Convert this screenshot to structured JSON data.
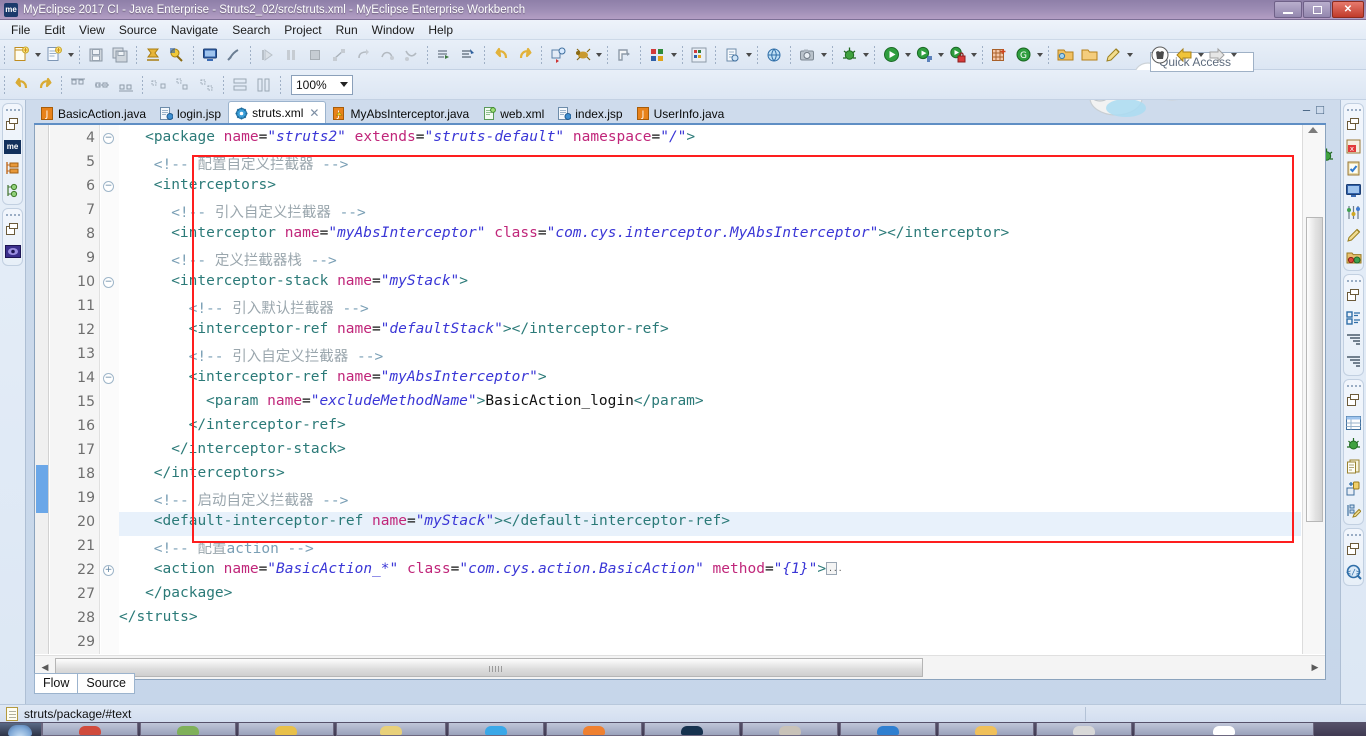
{
  "window": {
    "title": "MyEclipse 2017 CI - Java Enterprise - Struts2_02/src/struts.xml - MyEclipse Enterprise Workbench",
    "app_badge": "me",
    "minimize_label": "–",
    "maximize_label": "❐",
    "close_label": "✕"
  },
  "menubar": {
    "items": [
      {
        "label": "File",
        "mnemonic": "F"
      },
      {
        "label": "Edit",
        "mnemonic": "E"
      },
      {
        "label": "View",
        "mnemonic": "V"
      },
      {
        "label": "Source",
        "mnemonic": "S"
      },
      {
        "label": "Navigate",
        "mnemonic": "N"
      },
      {
        "label": "Search",
        "mnemonic": "c"
      },
      {
        "label": "Project",
        "mnemonic": "P"
      },
      {
        "label": "Run",
        "mnemonic": "R"
      },
      {
        "label": "Window",
        "mnemonic": "W"
      },
      {
        "label": "Help",
        "mnemonic": "H"
      }
    ]
  },
  "toolbar": {
    "zoom_value": "100%",
    "quick_access_placeholder": "Quick Access",
    "row1_icons": [
      "new-wizard-icon",
      "new-wizard-dropdown",
      "new-jsp-icon",
      "new-jsp-dropdown",
      "save-icon",
      "save-all-icon",
      "package-explorer-icon",
      "deploy-icon",
      "server-icon",
      "disable-validation-icon",
      "resume-icon",
      "suspend-icon",
      "terminate-icon",
      "disconnect-icon",
      "step-return-icon",
      "step-over-icon",
      "step-into-icon",
      "open-type-icon",
      "open-task-icon",
      "undo-icon",
      "redo-icon",
      "run-last-tool-icon",
      "ant-build-icon",
      "ant-dropdown",
      "external-tools-icon",
      "color-palette-icon",
      "color-palette-dropdown",
      "matrix-icon"
    ],
    "row1_right_icons": [
      "open-resource-icon",
      "open-resource-dropdown",
      "web-browser-icon",
      "snapshot-icon",
      "snapshot-dropdown",
      "debug-icon",
      "debug-dropdown",
      "run-icon",
      "run-dropdown",
      "run-config-icon",
      "run-config-dropdown",
      "coverage-icon",
      "coverage-dropdown",
      "new-table-icon",
      "google-icon",
      "google-dropdown",
      "open-folder-icon",
      "open-folder2-icon",
      "edit-pencil-icon",
      "edit-dropdown"
    ],
    "row2_icons": [
      "undo-icon",
      "redo-icon",
      "align-top-icon",
      "align-middle-icon",
      "align-bottom-icon",
      "distribute-h-icon",
      "distribute-v-icon",
      "distribute-icon",
      "match-width-icon",
      "match-height-icon"
    ],
    "perspective_icons": [
      "open-perspective-icon",
      "myeclipse-perspective-icon",
      "java-ee-perspective-icon",
      "debug-perspective-icon",
      "sync-perspective-icon"
    ],
    "nav_icons": [
      "perspective-shirt-icon",
      "back-arrow-icon",
      "back-dropdown",
      "forward-arrow-icon",
      "forward-dropdown"
    ]
  },
  "left_sidebar": {
    "groups": [
      {
        "icons": [
          "restore-view-icon",
          "myeclipse-explorer-icon",
          "outline-tree-icon",
          "hierarchy-icon"
        ]
      },
      {
        "icons": [
          "restore-view-icon",
          "preview-icon"
        ]
      }
    ]
  },
  "right_sidebar": {
    "groups": [
      {
        "icons": [
          "restore-view-icon",
          "problems-icon",
          "tasks-icon",
          "console-icon",
          "servers-icon",
          "snippets-icon",
          "package-deploy-icon"
        ]
      },
      {
        "icons": [
          "restore-view-icon",
          "outline-icon",
          "indent-view-icon",
          "indent-view2-icon"
        ]
      },
      {
        "icons": [
          "restore-view-icon",
          "properties-table-icon",
          "debug-bug-icon",
          "documents-icon",
          "variables-icon",
          "edit-tree-icon"
        ]
      },
      {
        "icons": [
          "restore-view-icon",
          "code-search-icon"
        ]
      }
    ]
  },
  "editor_tabs": {
    "items": [
      {
        "label": "BasicAction.java",
        "icon": "java-file-icon",
        "active": false
      },
      {
        "label": "login.jsp",
        "icon": "jsp-file-icon",
        "active": false
      },
      {
        "label": "struts.xml",
        "icon": "struts-config-icon",
        "active": true,
        "closeable": true
      },
      {
        "label": "MyAbsInterceptor.java",
        "icon": "java-warning-file-icon",
        "active": false
      },
      {
        "label": "web.xml",
        "icon": "web-xml-icon",
        "active": false
      },
      {
        "label": "index.jsp",
        "icon": "jsp-file-icon",
        "active": false
      },
      {
        "label": "UserInfo.java",
        "icon": "java-file-icon",
        "active": false
      }
    ],
    "close_label": "✕",
    "minimize_label": "–",
    "maximize_label": "□"
  },
  "editor": {
    "highlighted_line": 19,
    "selection_marker_lines": [
      18,
      19
    ],
    "lines": [
      {
        "num": "4",
        "fold": "minus",
        "indent": 3,
        "tokens": [
          {
            "t": "tag",
            "v": "<package"
          },
          {
            "t": "sp",
            "v": " "
          },
          {
            "t": "atn",
            "v": "name"
          },
          {
            "t": "eq",
            "v": "="
          },
          {
            "t": "atv",
            "v": "\"struts2\""
          },
          {
            "t": "sp",
            "v": " "
          },
          {
            "t": "atn",
            "v": "extends"
          },
          {
            "t": "eq",
            "v": "="
          },
          {
            "t": "atv",
            "v": "\"struts-default\""
          },
          {
            "t": "sp",
            "v": " "
          },
          {
            "t": "atn",
            "v": "namespace"
          },
          {
            "t": "eq",
            "v": "="
          },
          {
            "t": "atv",
            "v": "\"/\""
          },
          {
            "t": "tag",
            "v": ">"
          }
        ]
      },
      {
        "num": "5",
        "fold": "",
        "indent": 4,
        "tokens": [
          {
            "t": "cmt",
            "v": "<!-- "
          },
          {
            "t": "cmtcn",
            "v": "配置自定义拦截器"
          },
          {
            "t": "cmt",
            "v": " -->"
          }
        ]
      },
      {
        "num": "6",
        "fold": "minus",
        "indent": 4,
        "tokens": [
          {
            "t": "tag",
            "v": "<interceptors>"
          }
        ]
      },
      {
        "num": "7",
        "fold": "",
        "indent": 6,
        "tokens": [
          {
            "t": "cmt",
            "v": "<!-- "
          },
          {
            "t": "cmtcn",
            "v": "引入自定义拦截器"
          },
          {
            "t": "cmt",
            "v": " -->"
          }
        ]
      },
      {
        "num": "8",
        "fold": "",
        "indent": 6,
        "tokens": [
          {
            "t": "tag",
            "v": "<interceptor"
          },
          {
            "t": "sp",
            "v": " "
          },
          {
            "t": "atn",
            "v": "name"
          },
          {
            "t": "eq",
            "v": "="
          },
          {
            "t": "atv",
            "v": "\"myAbsInterceptor\""
          },
          {
            "t": "sp",
            "v": " "
          },
          {
            "t": "atn",
            "v": "class"
          },
          {
            "t": "eq",
            "v": "="
          },
          {
            "t": "atv",
            "v": "\"com.cys.interceptor.MyAbsInterceptor\""
          },
          {
            "t": "tag",
            "v": "></interceptor>"
          }
        ]
      },
      {
        "num": "9",
        "fold": "",
        "indent": 6,
        "tokens": [
          {
            "t": "cmt",
            "v": "<!-- "
          },
          {
            "t": "cmtcn",
            "v": "定义拦截器栈"
          },
          {
            "t": "cmt",
            "v": " -->"
          }
        ]
      },
      {
        "num": "10",
        "fold": "minus",
        "indent": 6,
        "tokens": [
          {
            "t": "tag",
            "v": "<interceptor-stack"
          },
          {
            "t": "sp",
            "v": " "
          },
          {
            "t": "atn",
            "v": "name"
          },
          {
            "t": "eq",
            "v": "="
          },
          {
            "t": "atv",
            "v": "\"myStack\""
          },
          {
            "t": "tag",
            "v": ">"
          }
        ]
      },
      {
        "num": "11",
        "fold": "",
        "indent": 8,
        "tokens": [
          {
            "t": "cmt",
            "v": "<!-- "
          },
          {
            "t": "cmtcn",
            "v": "引入默认拦截器"
          },
          {
            "t": "cmt",
            "v": " -->"
          }
        ]
      },
      {
        "num": "12",
        "fold": "",
        "indent": 8,
        "tokens": [
          {
            "t": "tag",
            "v": "<interceptor-ref"
          },
          {
            "t": "sp",
            "v": " "
          },
          {
            "t": "atn",
            "v": "name"
          },
          {
            "t": "eq",
            "v": "="
          },
          {
            "t": "atv",
            "v": "\"defaultStack\""
          },
          {
            "t": "tag",
            "v": "></interceptor-ref>"
          }
        ]
      },
      {
        "num": "13",
        "fold": "",
        "indent": 8,
        "tokens": [
          {
            "t": "cmt",
            "v": "<!-- "
          },
          {
            "t": "cmtcn",
            "v": "引入自定义拦截器"
          },
          {
            "t": "cmt",
            "v": " -->"
          }
        ]
      },
      {
        "num": "14",
        "fold": "minus",
        "indent": 8,
        "tokens": [
          {
            "t": "tag",
            "v": "<interceptor-ref"
          },
          {
            "t": "sp",
            "v": " "
          },
          {
            "t": "atn",
            "v": "name"
          },
          {
            "t": "eq",
            "v": "="
          },
          {
            "t": "atv",
            "v": "\"myAbsInterceptor\""
          },
          {
            "t": "tag",
            "v": ">"
          }
        ]
      },
      {
        "num": "15",
        "fold": "",
        "indent": 10,
        "tokens": [
          {
            "t": "tag",
            "v": "<param"
          },
          {
            "t": "sp",
            "v": " "
          },
          {
            "t": "atn",
            "v": "name"
          },
          {
            "t": "eq",
            "v": "="
          },
          {
            "t": "atv",
            "v": "\"excludeMethodName\""
          },
          {
            "t": "tag",
            "v": ">"
          },
          {
            "t": "txt",
            "v": "BasicAction_login"
          },
          {
            "t": "tag",
            "v": "</param>"
          }
        ]
      },
      {
        "num": "16",
        "fold": "",
        "indent": 8,
        "tokens": [
          {
            "t": "tag",
            "v": "</interceptor-ref>"
          }
        ]
      },
      {
        "num": "17",
        "fold": "",
        "indent": 6,
        "tokens": [
          {
            "t": "tag",
            "v": "</interceptor-stack>"
          }
        ]
      },
      {
        "num": "18",
        "fold": "",
        "indent": 4,
        "tokens": [
          {
            "t": "tag",
            "v": "</interceptors>"
          }
        ]
      },
      {
        "num": "19",
        "fold": "",
        "indent": 4,
        "tokens": [
          {
            "t": "cmt",
            "v": "<!-- "
          },
          {
            "t": "cmtcn",
            "v": "启动自定义拦截器"
          },
          {
            "t": "cmt",
            "v": " -->"
          }
        ]
      },
      {
        "num": "20",
        "fold": "",
        "indent": 4,
        "tokens": [
          {
            "t": "tag",
            "v": "<default-interceptor-ref"
          },
          {
            "t": "sp",
            "v": " "
          },
          {
            "t": "atn",
            "v": "name"
          },
          {
            "t": "eq",
            "v": "="
          },
          {
            "t": "atv",
            "v": "\"myStack\""
          },
          {
            "t": "tag",
            "v": "></default-interceptor-ref>"
          }
        ]
      },
      {
        "num": "21",
        "fold": "",
        "indent": 4,
        "tokens": [
          {
            "t": "cmt",
            "v": "<!-- "
          },
          {
            "t": "cmtcn",
            "v": "配置"
          },
          {
            "t": "cmt",
            "v": "action -->"
          }
        ]
      },
      {
        "num": "22",
        "fold": "plus",
        "indent": 4,
        "tokens": [
          {
            "t": "tag",
            "v": "<action"
          },
          {
            "t": "sp",
            "v": " "
          },
          {
            "t": "atn",
            "v": "name"
          },
          {
            "t": "eq",
            "v": "="
          },
          {
            "t": "atv",
            "v": "\"BasicAction_*\""
          },
          {
            "t": "sp",
            "v": " "
          },
          {
            "t": "atn",
            "v": "class"
          },
          {
            "t": "eq",
            "v": "="
          },
          {
            "t": "atv",
            "v": "\"com.cys.action.BasicAction\""
          },
          {
            "t": "sp",
            "v": " "
          },
          {
            "t": "atn",
            "v": "method"
          },
          {
            "t": "eq",
            "v": "="
          },
          {
            "t": "atv",
            "v": "\"{1}\""
          },
          {
            "t": "tag",
            "v": ">"
          },
          {
            "t": "fold",
            "v": "..."
          }
        ]
      },
      {
        "num": "27",
        "fold": "",
        "indent": 3,
        "tokens": [
          {
            "t": "tag",
            "v": "</package>"
          }
        ]
      },
      {
        "num": "28",
        "fold": "",
        "indent": 0,
        "tokens": [
          {
            "t": "tag",
            "v": "</struts>"
          }
        ]
      },
      {
        "num": "29",
        "fold": "",
        "indent": 0,
        "tokens": []
      }
    ],
    "annotation": {
      "type": "red-rectangle",
      "color": "#fe1e1e"
    }
  },
  "bottom_tabs": {
    "items": [
      {
        "label": "Flow",
        "active": false
      },
      {
        "label": "Source",
        "active": true
      }
    ]
  },
  "statusbar": {
    "icon": "document-icon",
    "text": "struts/package/#text"
  },
  "taskbar": {
    "items": [
      {
        "name": "start-orb",
        "color": "#7fa8d6"
      },
      {
        "name": "task-item-1",
        "color": "#d04a3c",
        "width": 96
      },
      {
        "name": "task-item-2",
        "color": "#7fb05a",
        "width": 96
      },
      {
        "name": "task-item-3",
        "color": "#e8c04a",
        "width": 96
      },
      {
        "name": "task-item-4",
        "color": "#e8d07a",
        "width": 110
      },
      {
        "name": "task-item-5",
        "color": "#3aa8e8",
        "width": 96
      },
      {
        "name": "task-item-6",
        "color": "#ef8030",
        "width": 96
      },
      {
        "name": "task-item-7",
        "color": "#16324f",
        "width": 96
      },
      {
        "name": "task-item-8",
        "color": "#c8c2b8",
        "width": 96
      },
      {
        "name": "task-item-9",
        "color": "#2f7fd0",
        "width": 96
      },
      {
        "name": "task-item-10",
        "color": "#f0c05a",
        "width": 96
      },
      {
        "name": "task-item-11",
        "color": "#d8d8d8",
        "width": 96
      },
      {
        "name": "task-item-12",
        "color": "#ffffff",
        "width": 180
      }
    ]
  },
  "colors": {
    "title_gradient_start": "#8e7fa8",
    "accent_tab_underline": "#5f8ec4",
    "annotation_red": "#fe1e1e",
    "highlight_line": "#e8f1fb",
    "tag": "#2b7a78",
    "attr_name": "#c0267a",
    "attr_value": "#3a36d6",
    "comment": "#7a9fb5"
  }
}
